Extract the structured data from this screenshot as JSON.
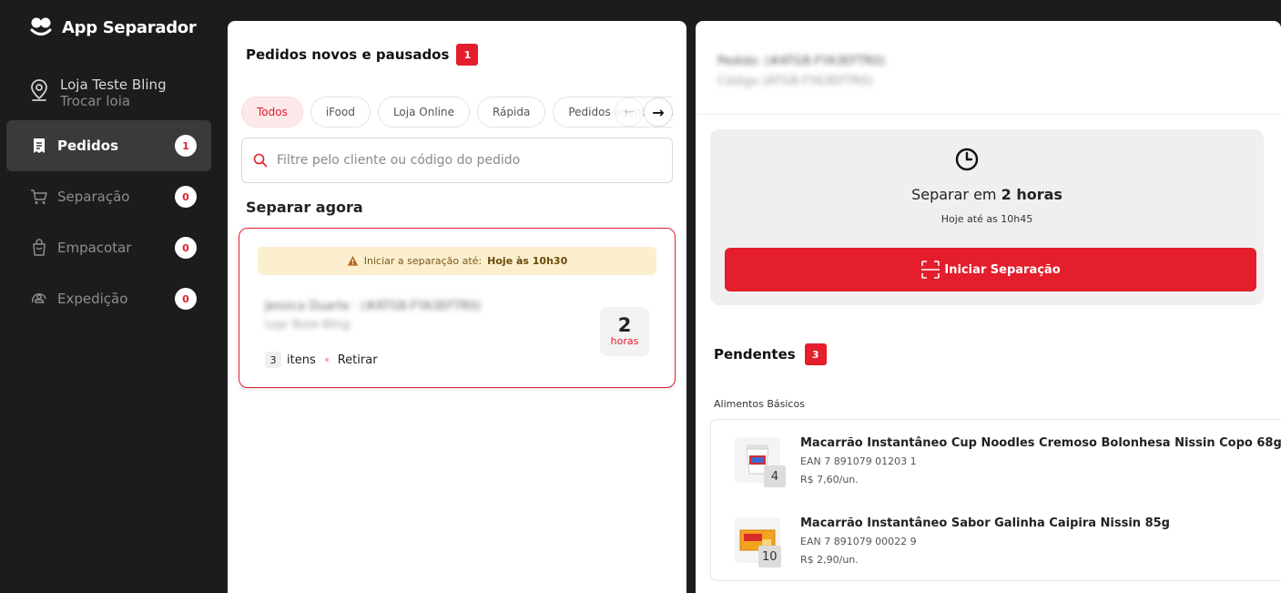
{
  "app": {
    "title": "App Separador"
  },
  "store": {
    "name": "Loja Teste Bling",
    "change_label": "Trocar loia"
  },
  "nav": [
    {
      "label": "Pedidos",
      "count": "1",
      "icon": "receipt-icon",
      "active": true
    },
    {
      "label": "Separação",
      "count": "0",
      "icon": "cart-icon",
      "active": false
    },
    {
      "label": "Empacotar",
      "count": "0",
      "icon": "bag-icon",
      "active": false
    },
    {
      "label": "Expedição",
      "count": "0",
      "icon": "delivery-icon",
      "active": false
    }
  ],
  "orders_panel": {
    "title": "Pedidos novos e pausados",
    "count": "1",
    "filters": [
      "Todos",
      "iFood",
      "Loja Online",
      "Rápida",
      "Pedidos agendados"
    ],
    "active_filter": "Todos",
    "search_placeholder": "Filtre pelo cliente ou código do pedido",
    "section_title": "Separar agora",
    "order": {
      "warning_prefix": "Iniciar a separação até:",
      "warning_time": "Hoje às 10h30",
      "customer_blurred": "Jessica Duarte · (#ATG8-FYA3EFTR0)",
      "store_blurred": "Loja Teste Bling",
      "items_count": "3",
      "items_label": "itens",
      "delivery_type": "Retirar",
      "time_value": "2",
      "time_unit": "horas"
    }
  },
  "detail_panel": {
    "order_blurred": "Pedido: (#ATG8-FYA3EFTR0)",
    "code_blurred": "Código (ATG8-FYA3EFTR0)",
    "separate_prefix": "Separar em",
    "separate_time": "2 horas",
    "deadline": "Hoje até as 10h45",
    "start_button": "Iniciar Separação",
    "pending_title": "Pendentes",
    "pending_count": "3",
    "category": "Alimentos Básicos",
    "products": [
      {
        "name": "Macarrão Instantâneo Cup Noodles Cremoso Bolonhesa Nissin Copo 68g",
        "ean": "EAN 7 891079 01203 1",
        "price": "R$ 7,60/un.",
        "qty": "4"
      },
      {
        "name": "Macarrão Instantâneo Sabor Galinha Caipira Nissin 85g",
        "ean": "EAN 7 891079 00022 9",
        "price": "R$ 2,90/un.",
        "qty": "10"
      }
    ]
  },
  "colors": {
    "brand_red": "#e41e2c",
    "sidebar_bg": "#1c1c1c",
    "warning_bg": "#fcefcf"
  }
}
